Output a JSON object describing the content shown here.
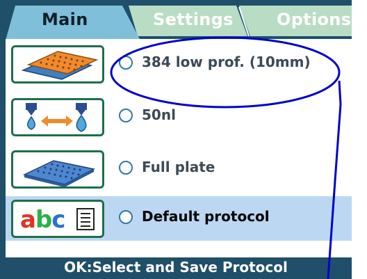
{
  "tabs": [
    {
      "label": "Main",
      "active": true
    },
    {
      "label": "Settings",
      "active": false
    },
    {
      "label": "Options",
      "active": false
    }
  ],
  "rows": [
    {
      "label": "384 low prof. (10mm)",
      "icon": "plate-384-icon",
      "selected": false
    },
    {
      "label": "50nl",
      "icon": "dispense-volume-icon",
      "selected": false
    },
    {
      "label": "Full plate",
      "icon": "full-plate-icon",
      "selected": false
    },
    {
      "label": "Default protocol",
      "icon": "protocol-name-icon",
      "selected": true
    }
  ],
  "protocol_icon_text": {
    "a": "a",
    "b": "b",
    "c": "c"
  },
  "status_bar": {
    "text": "OK:Select and Save Protocol"
  },
  "colors": {
    "frame": "#1f4f69",
    "active_tab": "#7fbfd9",
    "inactive_tab": "#b9dcc5",
    "selected_row": "#bcd7f2",
    "annotation": "#0000cc"
  }
}
